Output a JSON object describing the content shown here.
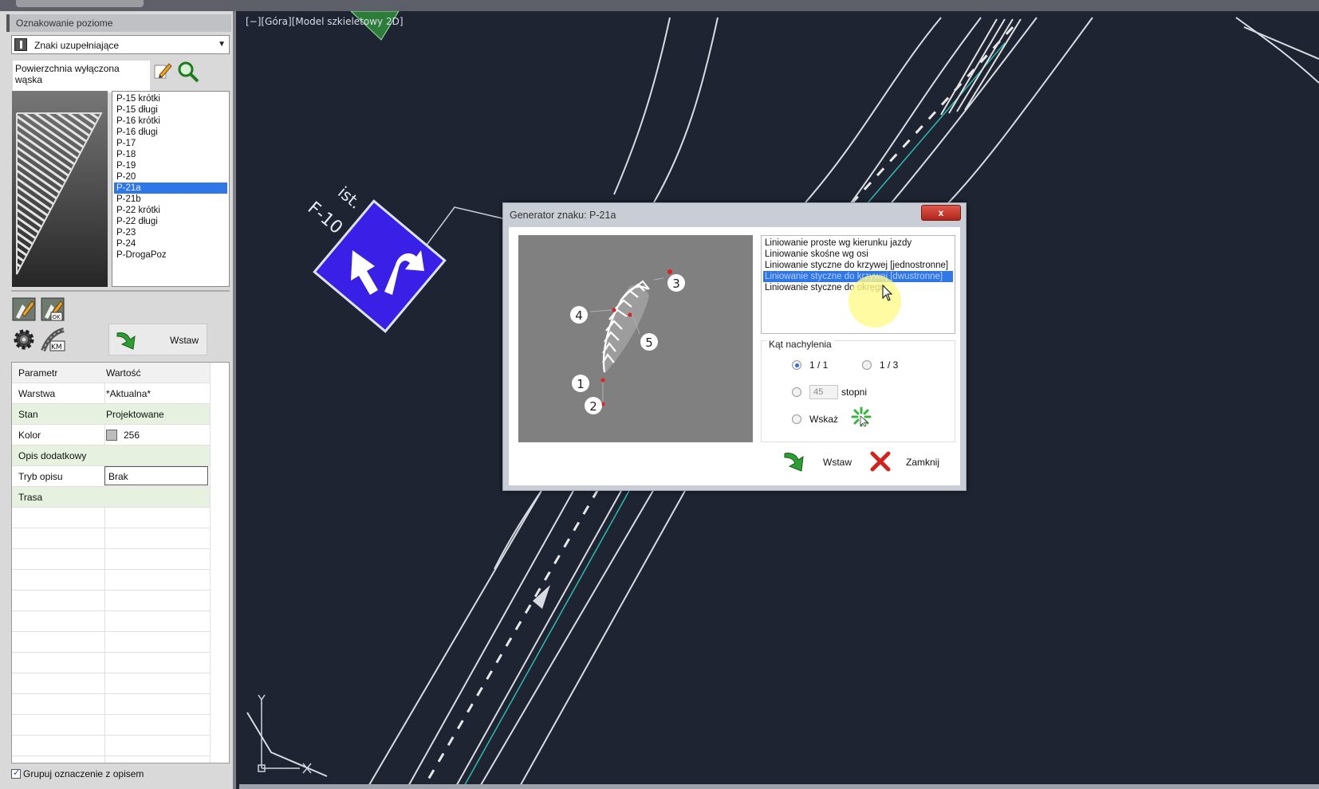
{
  "panel": {
    "title": "Oznakowanie poziome",
    "category_select": "Znaki uzupełniające",
    "surface_label": "Powierzchnia wyłączona wąska",
    "sign_list": [
      "P-15 krótki",
      "P-15 długi",
      "P-16 krótki",
      "P-16 długi",
      "P-17",
      "P-18",
      "P-19",
      "P-20",
      "P-21a",
      "P-21b",
      "P-22 krótki",
      "P-22 długi",
      "P-23",
      "P-24",
      "P-DrogaPoz"
    ],
    "selected_sign": "P-21a",
    "insert_label": "Wstaw",
    "km_label": "KM",
    "props": {
      "header_param": "Parametr",
      "header_value": "Wartość",
      "warstwa_k": "Warstwa",
      "warstwa_v": "*Aktualna*",
      "stan_k": "Stan",
      "stan_v": "Projektowane",
      "kolor_k": "Kolor",
      "kolor_v": "256",
      "opis_k": "Opis dodatkowy",
      "tryb_k": "Tryb opisu",
      "tryb_v": "Brak",
      "trasa_k": "Trasa"
    },
    "group_checkbox": "Grupuj oznaczenie z opisem"
  },
  "viewport": {
    "label": "[−][Góra][Model szkieletowy 2D]",
    "sign_text_1": "F-10",
    "sign_text_2": "ist."
  },
  "dialog": {
    "title": "Generator znaku: P-21a",
    "close": "x",
    "options": [
      "Liniowanie proste wg kierunku jazdy",
      "Liniowanie skośne wg osi",
      "Liniowanie styczne do krzywej [jednostronne]",
      "Liniowanie styczne do krzywej [dwustronne]",
      "Liniowanie styczne do okręgu"
    ],
    "selected_option": "Liniowanie styczne do krzywej [dwustronne]",
    "angle_legend": "Kąt nachylenia",
    "ratio1": "1 / 1",
    "ratio2": "1 / 3",
    "deg_value": "45",
    "deg_unit": "stopni",
    "pick_label": "Wskaż",
    "insert": "Wstaw",
    "close_btn": "Zamknij",
    "preview_points": [
      "1",
      "2",
      "3",
      "4",
      "5"
    ]
  },
  "colors": {
    "selection": "#2f76e6",
    "canvas": "#1f2432",
    "road_line": "#d8dbe2",
    "road_axis": "#2fb9b2",
    "sign_blue": "#3a1fe6"
  }
}
